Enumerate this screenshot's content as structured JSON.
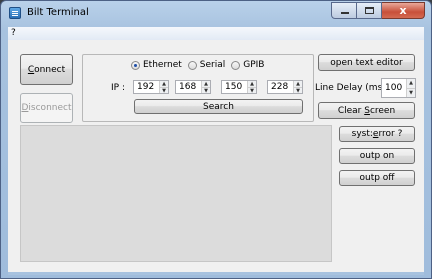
{
  "window": {
    "title": "Bilt Terminal",
    "close_glyph": "x"
  },
  "menu": {
    "help_label": "?"
  },
  "connect": {
    "prefix": "",
    "accel": "C",
    "rest": "onnect"
  },
  "disconnect": {
    "prefix": "",
    "accel": "D",
    "rest": "isconnect"
  },
  "interface": {
    "options": [
      "Ethernet",
      "Serial",
      "GPIB"
    ],
    "selected": "Ethernet"
  },
  "ip": {
    "label": "IP :",
    "octets": [
      "192",
      "168",
      "150",
      "228"
    ]
  },
  "search_label": "Search",
  "open_editor_label": "open text editor",
  "line_delay": {
    "label": "Line Delay (ms) :",
    "value": "100"
  },
  "clear": {
    "prefix": "Clear ",
    "accel": "S",
    "rest": "creen"
  },
  "syst_error": {
    "prefix": "syst:",
    "accel": "e",
    "rest": "rror ?"
  },
  "outp_on_label": "outp on",
  "outp_off_label": "outp off",
  "console_text": "",
  "icons": {
    "app": "terminal-icon",
    "up": "▲",
    "down": "▼"
  }
}
